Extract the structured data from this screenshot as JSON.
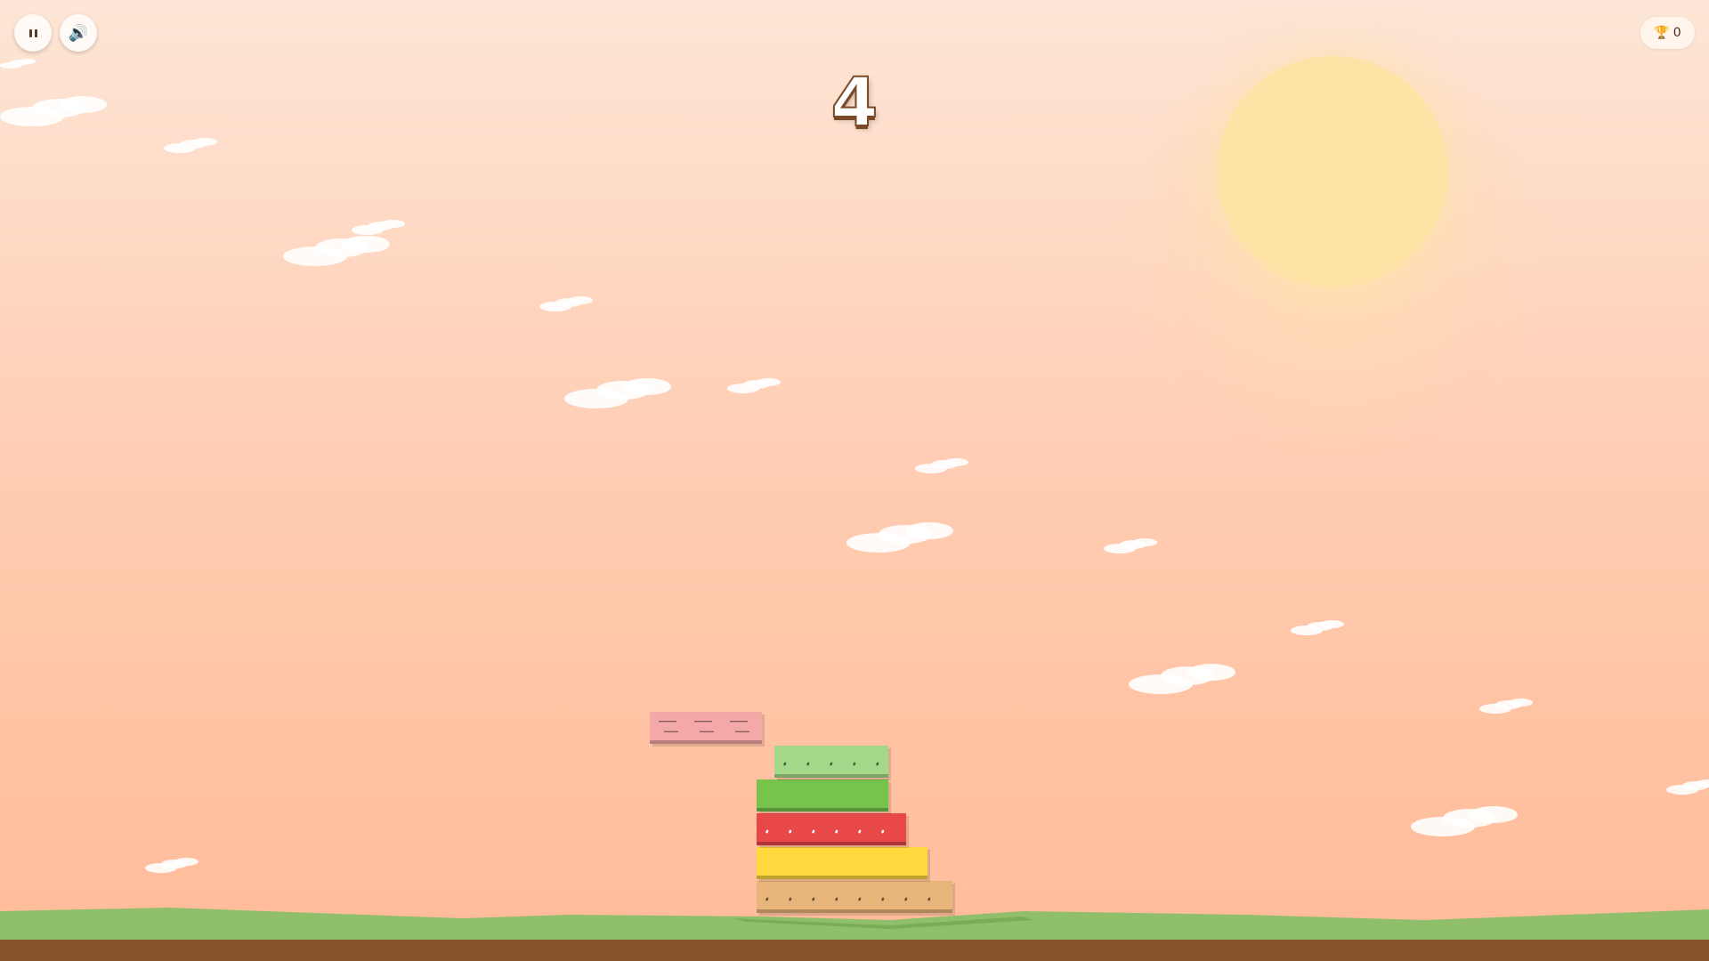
{
  "hud": {
    "score": "4",
    "best_score": "0",
    "pause_icon": "pause-icon",
    "sound_icon": "speaker-icon",
    "trophy_icon": "trophy-icon",
    "trophy_glyph": "🏆",
    "speaker_glyph": "🔊"
  },
  "colors": {
    "sky_top": "#fde6d6",
    "sky_bottom": "#ffbb9a",
    "sun": "#ffe3a6",
    "grass": "#8fbf6a",
    "dirt": "#875429"
  },
  "tower": {
    "stacked_count": 5,
    "blocks": [
      {
        "name": "bread-layer",
        "color": "#e8b57a",
        "pattern": "seeds"
      },
      {
        "name": "cheese-layer",
        "color": "#ffd93d",
        "pattern": "none"
      },
      {
        "name": "tomato-layer",
        "color": "#e84848",
        "pattern": "seeds"
      },
      {
        "name": "lettuce-layer",
        "color": "#76c44c",
        "pattern": "none"
      },
      {
        "name": "cucumber-layer",
        "color": "#a5d98a",
        "pattern": "seeds"
      }
    ],
    "moving_block": {
      "name": "ham-layer",
      "color": "#f4a9a8",
      "pattern": "stripes"
    }
  }
}
